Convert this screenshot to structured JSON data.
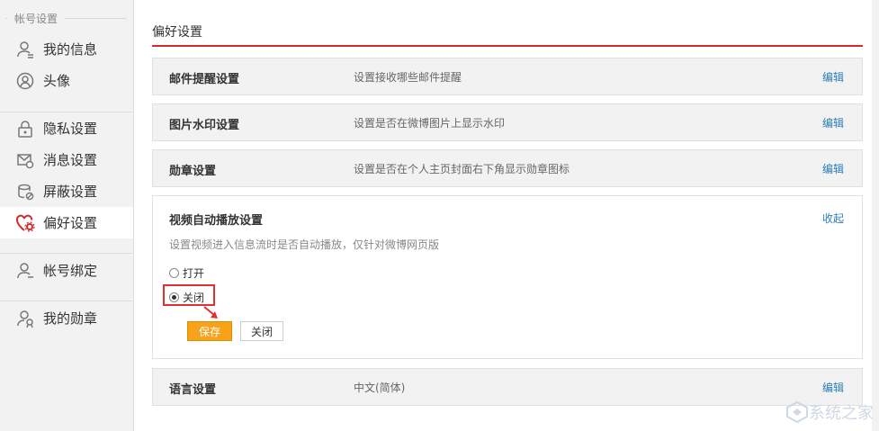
{
  "sidebar": {
    "section_title": "帐号设置",
    "items": [
      {
        "label": "我的信息",
        "icon": "user-info-icon"
      },
      {
        "label": "头像",
        "icon": "avatar-icon"
      },
      {
        "label": "隐私设置",
        "icon": "lock-icon"
      },
      {
        "label": "消息设置",
        "icon": "message-icon"
      },
      {
        "label": "屏蔽设置",
        "icon": "block-icon"
      },
      {
        "label": "偏好设置",
        "icon": "heart-gear-icon",
        "active": true
      },
      {
        "label": "帐号绑定",
        "icon": "account-bind-icon"
      },
      {
        "label": "我的勋章",
        "icon": "medal-icon"
      }
    ]
  },
  "main": {
    "title": "偏好设置",
    "rows": [
      {
        "name": "邮件提醒设置",
        "desc": "设置接收哪些邮件提醒",
        "action": "编辑"
      },
      {
        "name": "图片水印设置",
        "desc": "设置是否在微博图片上显示水印",
        "action": "编辑"
      },
      {
        "name": "勋章设置",
        "desc": "设置是否在个人主页封面右下角显示勋章图标",
        "action": "编辑"
      }
    ],
    "video": {
      "name": "视频自动播放设置",
      "collapse": "收起",
      "hint": "设置视频进入信息流时是否自动播放，仅针对微博网页版",
      "option_on": "打开",
      "option_off": "关闭",
      "selected": "关闭",
      "save": "保存",
      "close": "关闭"
    },
    "language": {
      "name": "语言设置",
      "desc": "中文(简体)",
      "action": "编辑"
    }
  },
  "watermark": {
    "text": "系统之家"
  },
  "colors": {
    "accent": "#d02b2b",
    "link": "#2a7eb8",
    "save_button": "#f7a21b"
  }
}
